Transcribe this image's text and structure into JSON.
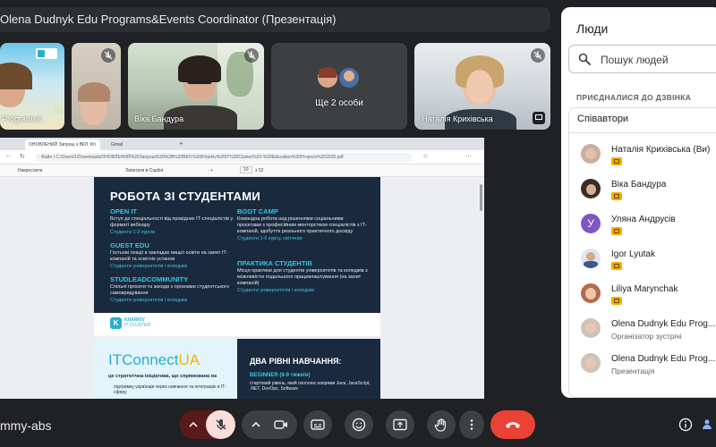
{
  "presenter_banner": "Olena Dudnyk Edu Programs&Events Coordinator (Презентація)",
  "tiles": [
    {
      "name": "Programs&",
      "muted": false
    },
    {
      "name": "",
      "muted": true
    },
    {
      "name": "Віка Бандура",
      "muted": true
    },
    {
      "name": "Ще 2 особи",
      "muted": false
    },
    {
      "name": "Наталія Крихівська",
      "muted": true
    }
  ],
  "browser": {
    "tabs": [
      "ОНОВЛЕНИЙ Запрош з ВКЛ. Kh",
      "Gmail"
    ],
    "url": "Файл | C:/Users/1/Downloads/ОНОВЛЕНИЙ%20Запрош%20%2B%20ВКЛ.%20Kharkiv%20IT%20Cluster%20-%20Education%20Projects%202025.pdf",
    "pdf_toolbar": {
      "highlight": "Накреслити",
      "ask": "Запитати в Copilot",
      "page_current": "10",
      "page_total": "з 32",
      "zoom": "-   +"
    }
  },
  "slide1": {
    "title": "РОБОТА ЗІ СТУДЕНТАМИ",
    "sections": [
      {
        "title": "OPEN IT",
        "desc": "Вступ до спеціальності від провідних ІТ-спеціалістів у форматі вебінару",
        "target": "Студенти 1-3 курсів"
      },
      {
        "title": "BOOT CAMP",
        "desc": "Командна робота над рішеннями соціальними проєктами з професійним ментор­ством спеціалістів з ІТ-компаній, здобуття реального практичного досвіду",
        "target": "Студенти 1-6 курсу, світчери"
      },
      {
        "title": "GUEST EDU",
        "desc": "Гостьові лекції в закладах вищої освіти на запит ІТ-компаній та освітніх установ",
        "target": "Студенти університетів і коледжів"
      },
      {
        "title": "ПРАКТИКА СТУДЕНТІВ",
        "desc": "Місця практики для студентів університетів та коледжів з можливістю подальшого працевлаштування (на запит компаній)",
        "target": "Студенти університетів і коледжів"
      },
      {
        "title": "STUDLEADCOMMUNITY",
        "desc": "Спільні проєкти та заходи з органами студентського самоврядування",
        "target": "Студенти університетів і коледжів"
      }
    ],
    "logo_line1": "KHARKIV",
    "logo_line2": "IT CLUSTER"
  },
  "slide2": {
    "brand_it": "ITConnect",
    "brand_ua": "UA",
    "sub": "це стратегічна ініціатива, що спрямована на",
    "sub2": "підтримку українців через навчання та інтеграцію в IT-сферу",
    "heading": "ДВА РІВНІ НАВЧАННЯ:",
    "level": "BEGINNER (8-9 тижнів)",
    "level_desc": "стартовий рівень, який охоплює напрями Java, JavaScript, .NET, DevOps, Software"
  },
  "panel": {
    "title": "Люди",
    "search_placeholder": "Пошук людей",
    "joined_label": "ПРИЄДНАЛИСЯ ДО ДЗВІНКА",
    "group_title": "Співавтори",
    "people": [
      {
        "name": "Наталія Крихівська (Ви)",
        "role": "",
        "badge": true
      },
      {
        "name": "Віка Бандура",
        "role": "",
        "badge": true
      },
      {
        "name": "Уляна Андрусів",
        "role": "",
        "badge": true,
        "initial": "У"
      },
      {
        "name": "Igor Lyutak",
        "role": "",
        "badge": true
      },
      {
        "name": "Liliya Marynchak",
        "role": "",
        "badge": true
      },
      {
        "name": "Olena Dudnyk Edu Prog...",
        "role": "Організатор зустрічі",
        "badge": false
      },
      {
        "name": "Olena Dudnyk Edu Prog...",
        "role": "Презентація",
        "badge": false
      }
    ]
  },
  "bottom_bar": {
    "meeting_code": "mmy-abs"
  },
  "colors": {
    "accent_teal": "#36c7e0",
    "end_call": "#ea4335",
    "mic_off_bg": "#f9dedc",
    "badge": "#f9ab00",
    "avatar_purple": "#7e57c2"
  }
}
